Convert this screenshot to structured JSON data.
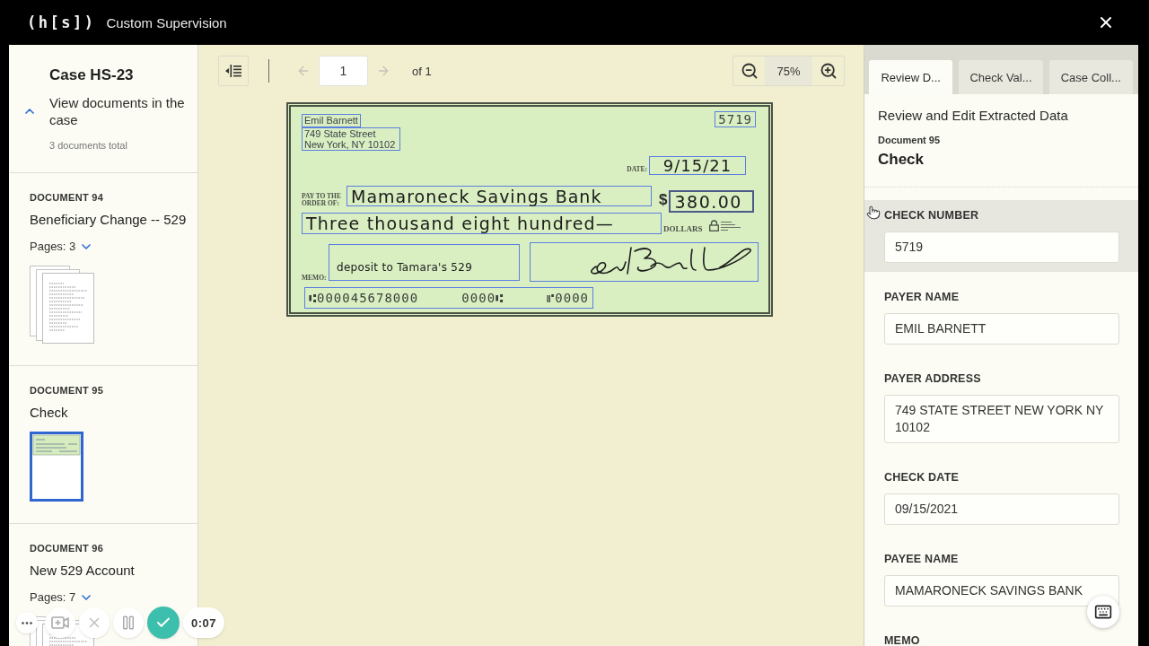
{
  "app_bar": {
    "logo": "(h[s])",
    "title": "Custom Supervision"
  },
  "case_panel": {
    "title": "Case HS-23",
    "toggle_label": "View documents in the case",
    "expanded": true,
    "summary": "3 documents total"
  },
  "documents": [
    {
      "label": "DOCUMENT 94",
      "name": "Beneficiary Change -- 529",
      "pages": "Pages: 3",
      "kind": "stack",
      "selected": false
    },
    {
      "label": "DOCUMENT 95",
      "name": "Check",
      "kind": "single",
      "selected": true
    },
    {
      "label": "DOCUMENT 96",
      "name": "New 529 Account",
      "pages": "Pages: 7",
      "kind": "stack",
      "selected": false
    }
  ],
  "viewer_toolbar": {
    "page": "1",
    "page_count": "of 1",
    "zoom": "75%",
    "prev_disabled": true,
    "next_disabled": true
  },
  "check": {
    "payer_name": "Emil Barnett",
    "payer_address": [
      "749 State Street",
      "New York, NY 10102"
    ],
    "number": "5719",
    "date_label": "DATE:",
    "date": "9/15/21",
    "pay_label": "PAY TO THE ORDER OF:",
    "payee": "Mamaroneck Savings Bank",
    "currency": "$",
    "amount": "380.00",
    "amount_words": "Three thousand eight hundred—",
    "dollars_label": "DOLLARS",
    "memo_label": "MEMO:",
    "memo": "deposit to Tamara's 529",
    "micr": [
      "⑆000045678000",
      "0000⑆",
      "⑈0000"
    ]
  },
  "review_panel": {
    "tabs": [
      {
        "label": "Review D...",
        "selected": true
      },
      {
        "label": "Check Val...",
        "selected": false
      },
      {
        "label": "Case Coll...",
        "selected": false
      }
    ],
    "heading": "Review and Edit Extracted Data",
    "document_label": "Document 95",
    "document_name": "Check",
    "fields": [
      {
        "label": "CHECK NUMBER",
        "value": "5719",
        "highlighted": true
      },
      {
        "label": "PAYER NAME",
        "value": "EMIL BARNETT",
        "highlighted": false
      },
      {
        "label": "PAYER ADDRESS",
        "value": "749 STATE STREET NEW YORK NY 10102",
        "highlighted": false
      },
      {
        "label": "CHECK DATE",
        "value": "09/15/2021",
        "highlighted": false
      },
      {
        "label": "PAYEE NAME",
        "value": "MAMARONECK SAVINGS BANK",
        "highlighted": false
      },
      {
        "label": "MEMO",
        "highlighted": false
      }
    ]
  },
  "recorder": {
    "timer": "0:07"
  }
}
